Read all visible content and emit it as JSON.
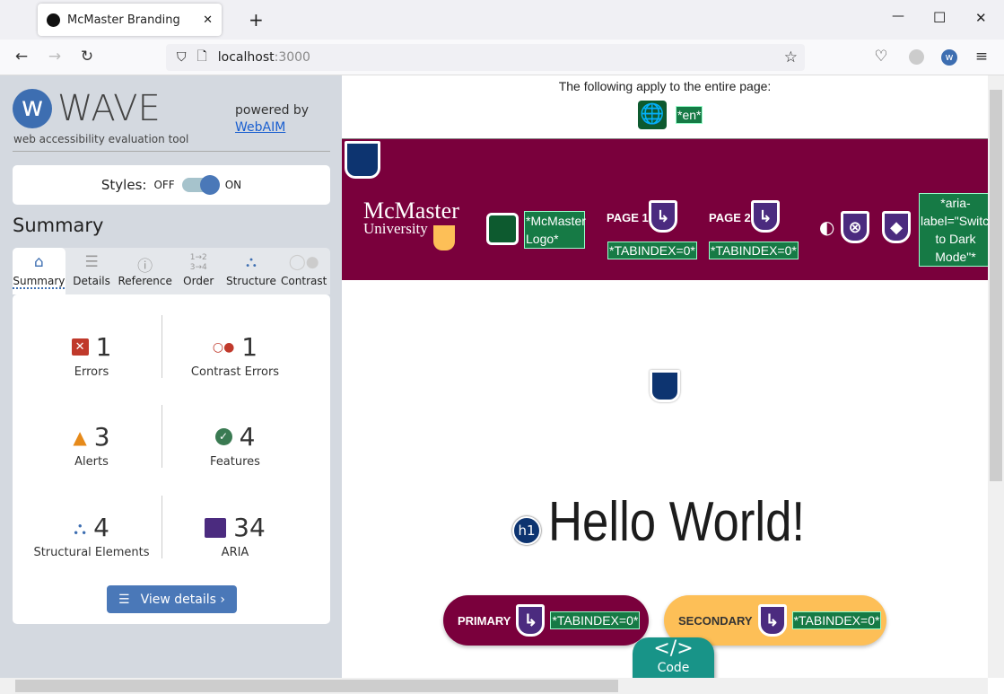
{
  "browser": {
    "tab_title": "McMaster Branding",
    "new_tab": "+",
    "url_host": "localhost",
    "url_port": ":3000",
    "win_min": "—",
    "win_max": "☐",
    "win_close": "✕"
  },
  "wave": {
    "logo_text": "WAVE",
    "tagline": "web accessibility evaluation tool",
    "powered_by": "powered by",
    "webaim_link": "WebAIM",
    "styles_label": "Styles:",
    "styles_off": "OFF",
    "styles_on": "ON",
    "styles_enabled": true,
    "summary_heading": "Summary",
    "tabs": [
      {
        "label": "Summary",
        "icon": "home-icon"
      },
      {
        "label": "Details",
        "icon": "list-icon"
      },
      {
        "label": "Reference",
        "icon": "info-icon"
      },
      {
        "label": "Order",
        "icon": "order-icon"
      },
      {
        "label": "Structure",
        "icon": "structure-icon"
      },
      {
        "label": "Contrast",
        "icon": "contrast-icon"
      }
    ],
    "stats": [
      {
        "count": "1",
        "label": "Errors",
        "color": "#c0392b"
      },
      {
        "count": "1",
        "label": "Contrast Errors",
        "color": "#c0392b"
      },
      {
        "count": "3",
        "label": "Alerts",
        "color": "#e68a1a"
      },
      {
        "count": "4",
        "label": "Features",
        "color": "#3a7a52"
      },
      {
        "count": "4",
        "label": "Structural Elements",
        "color": "#3d6eb1"
      },
      {
        "count": "34",
        "label": "ARIA",
        "color": "#4b2b7f"
      }
    ],
    "view_details": "View details ›"
  },
  "page": {
    "notice": "The following apply to the entire page:",
    "lang_tag": "*en*",
    "brand_line1": "McMaster",
    "brand_line2": "University",
    "logo_alt": "*McMaster Logo*",
    "nav": [
      {
        "label": "PAGE 1",
        "tag": "*TABINDEX=0*"
      },
      {
        "label": "PAGE 2",
        "tag": "*TABINDEX=0*"
      }
    ],
    "aria_label_tag": "*aria-label=\"Switch to Dark Mode\"*",
    "heading_badge": "h1",
    "heading": "Hello World!",
    "primary_label": "PRIMARY",
    "primary_tag": "*TABINDEX=0*",
    "secondary_label": "SECONDARY",
    "secondary_tag": "*TABINDEX=0*",
    "code_label": "Code",
    "code_icon": "</>"
  },
  "colors": {
    "maroon": "#7a003c",
    "gold": "#fdbf57",
    "aria_purple": "#4b2b7f",
    "wave_blue": "#3d6eb1",
    "feature_green": "#167a45"
  }
}
